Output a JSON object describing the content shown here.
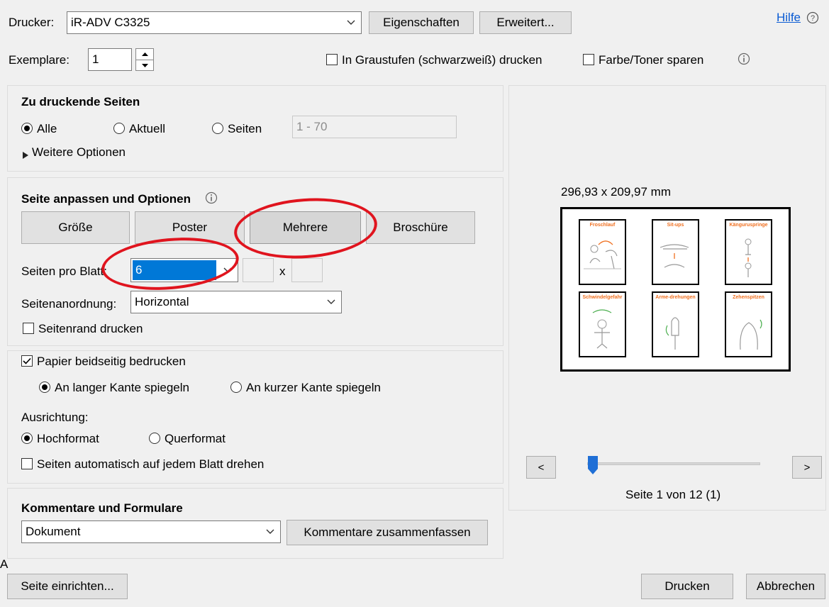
{
  "header": {
    "printer_label": "Drucker:",
    "printer_value": "iR-ADV C3325",
    "properties_button": "Eigenschaften",
    "advanced_button": "Erweitert...",
    "help_link": "Hilfe",
    "copies_label": "Exemplare:",
    "copies_value": "1",
    "grayscale_label": "In Graustufen (schwarzweiß) drucken",
    "grayscale_checked": false,
    "save_toner_label": "Farbe/Toner sparen",
    "save_toner_checked": false
  },
  "pages_to_print": {
    "heading": "Zu druckende Seiten",
    "all_label": "Alle",
    "current_label": "Aktuell",
    "pages_label": "Seiten",
    "pages_range_placeholder": "1 - 70",
    "selected": "all",
    "more_options": "Weitere Optionen"
  },
  "page_sizing": {
    "heading": "Seite anpassen und Optionen",
    "tabs": [
      "Größe",
      "Poster",
      "Mehrere",
      "Broschüre"
    ],
    "active_tab": "Mehrere",
    "pages_per_sheet_label": "Seiten pro Blatt:",
    "pages_per_sheet_value": "6",
    "times_sign": "x",
    "page_order_label": "Seitenanordnung:",
    "page_order_value": "Horizontal",
    "print_border_label": "Seitenrand drucken",
    "print_border_checked": false
  },
  "duplex": {
    "duplex_label": "Papier beidseitig bedrucken",
    "duplex_checked": true,
    "long_edge_label": "An langer Kante spiegeln",
    "short_edge_label": "An kurzer Kante spiegeln",
    "flip_selected": "long",
    "orientation_label": "Ausrichtung:",
    "portrait_label": "Hochformat",
    "landscape_label": "Querformat",
    "orientation_selected": "portrait",
    "auto_rotate_label": "Seiten automatisch auf jedem Blatt drehen",
    "auto_rotate_checked": false
  },
  "comments": {
    "heading": "Kommentare und Formulare",
    "value": "Dokument",
    "summarize_button": "Kommentare zusammenfassen"
  },
  "preview": {
    "dimensions": "296,93 x 209,97 mm",
    "thumbnails": [
      {
        "title": "Froschlauf"
      },
      {
        "title": "Sit-ups"
      },
      {
        "title": "Känguruspringe"
      },
      {
        "title": "Schwindelgefahr"
      },
      {
        "title": "Arme-drehungen"
      },
      {
        "title": "Zehenspitzen"
      }
    ],
    "prev_button": "<",
    "next_button": ">",
    "page_indicator": "Seite 1 von 12 (1)",
    "slider_position": 0
  },
  "footer": {
    "stray_letter": "A",
    "page_setup_button": "Seite einrichten...",
    "print_button": "Drucken",
    "cancel_button": "Abbrechen"
  },
  "colors": {
    "annotation_red": "#e0141e",
    "selection_blue": "#0078d7",
    "slider_blue": "#1f6fd6"
  },
  "icons": {
    "info": "info-icon",
    "help": "help-icon",
    "dropdown": "chevron-down-icon",
    "spinner_up": "spinner-up-icon",
    "spinner_down": "spinner-down-icon",
    "expand": "triangle-right-icon"
  }
}
